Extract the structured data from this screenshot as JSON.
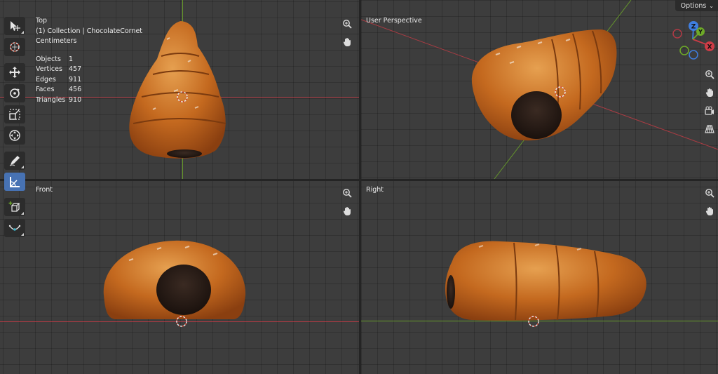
{
  "header": {
    "options_label": "Options"
  },
  "viewports": {
    "top": {
      "label": "Top",
      "collection": "(1) Collection | ChocolateCornet",
      "units": "Centimeters",
      "stats": [
        {
          "label": "Objects",
          "value": "1"
        },
        {
          "label": "Vertices",
          "value": "457"
        },
        {
          "label": "Edges",
          "value": "911"
        },
        {
          "label": "Faces",
          "value": "456"
        },
        {
          "label": "Triangles",
          "value": "910"
        }
      ]
    },
    "perspective": {
      "label": "User Perspective"
    },
    "front": {
      "label": "Front"
    },
    "right": {
      "label": "Right"
    }
  },
  "gizmo": {
    "x": "X",
    "y": "Y",
    "z": "Z"
  },
  "colors": {
    "viewport_bg": "#3d3d3d",
    "active_tool": "#4772b3",
    "x_axis": "#cd3c46",
    "y_axis": "#6eaa28",
    "z_axis": "#3f7ee0",
    "bread": "#c4691f",
    "chocolate": "#2a1d17"
  },
  "toolbar": {
    "tools": [
      {
        "icon": "tweak-select-icon",
        "active": false
      },
      {
        "icon": "cursor-icon",
        "active": false
      },
      {
        "icon": "move-icon",
        "active": false
      },
      {
        "icon": "rotate-icon",
        "active": false
      },
      {
        "icon": "scale-icon",
        "active": false
      },
      {
        "icon": "transform-icon",
        "active": false
      },
      {
        "icon": "annotate-icon",
        "active": false
      },
      {
        "icon": "measure-icon",
        "active": true
      },
      {
        "icon": "add-cube-icon",
        "active": false
      },
      {
        "icon": "curve-icon",
        "active": false
      }
    ]
  }
}
